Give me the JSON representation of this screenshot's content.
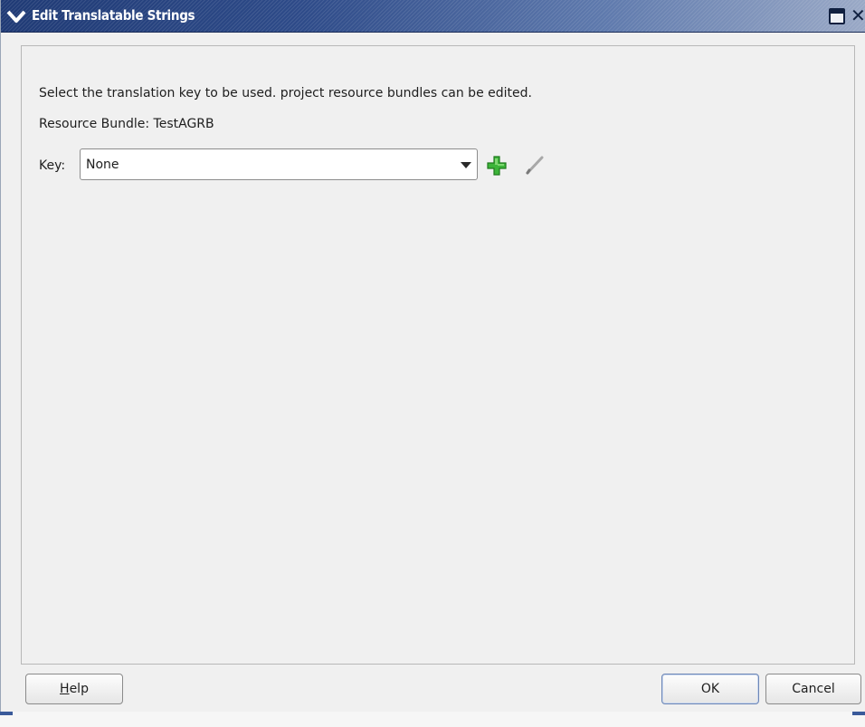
{
  "window": {
    "title": "Edit Translatable Strings",
    "icons": {
      "menu": "chevron-down-icon",
      "maximize": "maximize-icon",
      "close": "close-icon"
    }
  },
  "content": {
    "instruction": "Select the translation key to be used. project resource bundles can be edited.",
    "resource_bundle": "Resource Bundle: TestAGRB",
    "key_label": "Key:",
    "key_value": "None",
    "icons": {
      "add": "add-icon",
      "edit": "edit-pencil-icon"
    }
  },
  "buttons": {
    "help_mnemonic": "H",
    "help_rest": "elp",
    "ok": "OK",
    "cancel": "Cancel"
  },
  "colors": {
    "title_gradient_start": "#1f3a75",
    "title_gradient_end": "#9aa9c6",
    "add_icon": "#3db53a",
    "background": "#f0f0f0"
  }
}
